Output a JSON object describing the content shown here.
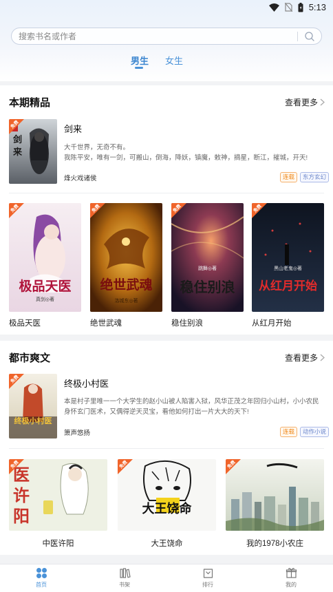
{
  "status_bar": {
    "time": "5:13"
  },
  "search": {
    "placeholder": "搜索书名或作者"
  },
  "gender_tabs": [
    {
      "label": "男生",
      "active": true
    },
    {
      "label": "女生",
      "active": false
    }
  ],
  "sections": [
    {
      "title": "本期精品",
      "more_label": "查看更多",
      "featured": {
        "title": "剑来",
        "description_line1": "大千世界，无奇不有。",
        "description_line2": "我陈平安，唯有一剑，可搬山，倒海，降妖，镇魔，敕神，摘星，断江，摧城，开天!",
        "author": "烽火戏诸侯",
        "status_tag": "连载",
        "genre_tag": "东方玄幻"
      },
      "books": [
        {
          "title": "极品天医",
          "cover_text": "极品天医",
          "cover_author": "真剑◎著",
          "badge": "免费"
        },
        {
          "title": "绝世武魂",
          "cover_text": "绝世武魂",
          "cover_author": "洛城东◎著",
          "badge": "免费"
        },
        {
          "title": "稳住别浪",
          "cover_text": "稳住别浪",
          "cover_author": "跳舞◎著",
          "badge": "免费"
        },
        {
          "title": "从红月开始",
          "cover_text": "从红月开始",
          "cover_author": "黑山老鬼◎著",
          "badge": "免费"
        }
      ]
    },
    {
      "title": "都市爽文",
      "more_label": "查看更多",
      "featured": {
        "title": "终极小村医",
        "description_line1": "本是村子里唯一一个大学生的赵小山被人陷害入狱，风华正茂之年回归小山村，小小农民",
        "description_line2": "身怀玄门医术，又偶得逆天灵宝，看他如何打出一片大大的天下!",
        "author": "箫声悠扬",
        "status_tag": "连载",
        "genre_tag": "动作小说",
        "cover_text": "终极小村医",
        "badge": "免费"
      },
      "books": [
        {
          "title": "中医许阳",
          "cover_text": "医许阳",
          "badge": "免费"
        },
        {
          "title": "大王饶命",
          "cover_text": "大王饶命",
          "badge": "免费"
        },
        {
          "title": "我的1978小农庄",
          "cover_text": "",
          "badge": "免费"
        }
      ]
    }
  ],
  "bottom_nav": [
    {
      "label": "首页",
      "icon": "home-icon",
      "active": true
    },
    {
      "label": "书架",
      "icon": "bookshelf-icon",
      "active": false
    },
    {
      "label": "排行",
      "icon": "ranking-icon",
      "active": false
    },
    {
      "label": "我的",
      "icon": "profile-icon",
      "active": false
    }
  ],
  "colors": {
    "accent": "#4a92d8",
    "badge": "#f0642a",
    "status_tag": "#f08a1c",
    "genre_tag": "#6a86c9"
  }
}
